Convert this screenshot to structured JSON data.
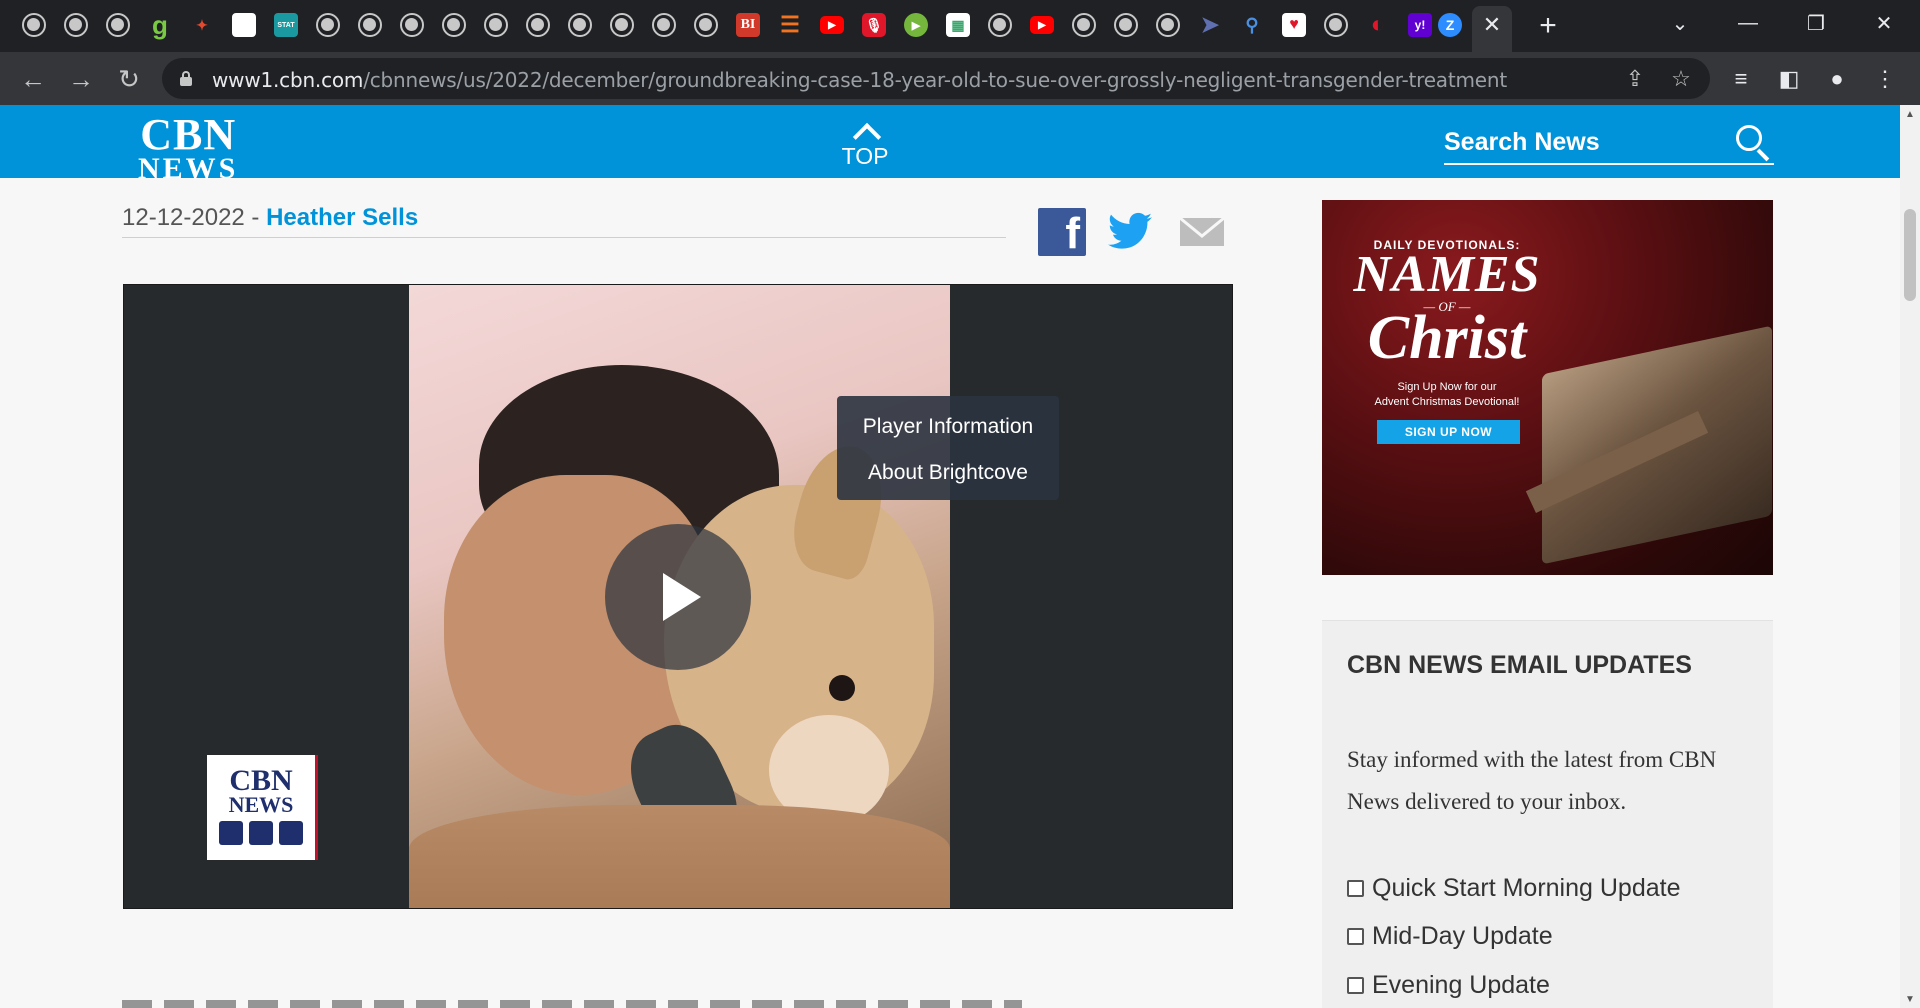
{
  "browser": {
    "url_host": "www1.cbn.com",
    "url_path": "/cbnnews/us/2022/december/groundbreaking-case-18-year-old-to-sue-over-grossly-negligent-transgender-treatment",
    "tab_close_glyph": "✕",
    "new_tab_glyph": "+",
    "favicon_letters": {
      "g": "g",
      "stat": "STAT",
      "bi": "BI",
      "yahoo": "y!",
      "z": "Z"
    },
    "icons": [
      "back-arrow-icon",
      "forward-arrow-icon",
      "reload-icon",
      "lock-icon",
      "share-icon",
      "star-icon",
      "reading-list-icon",
      "side-panel-icon",
      "profile-icon",
      "kebab-menu-icon"
    ]
  },
  "header": {
    "logo_line1": "CBN",
    "logo_line2": "NEWS",
    "top_label": "TOP",
    "search_placeholder": "Search News",
    "color": "#0093d9"
  },
  "article": {
    "date": "12-12-2022",
    "separator": " - ",
    "author": "Heather Sells"
  },
  "share": {
    "facebook_glyph": "f",
    "facebook_color": "#3b5998",
    "twitter_color": "#1da1f2",
    "email_color": "#bdbdbd"
  },
  "player": {
    "context_menu": [
      "Player Information",
      "About Brightcove"
    ],
    "watermark_line1": "CBN",
    "watermark_line2": "NEWS"
  },
  "ad": {
    "kicker": "DAILY DEVOTIONALS:",
    "headline1": "NAMES",
    "of": "— OF —",
    "headline2": "Christ",
    "subtext_line1": "Sign Up Now for our",
    "subtext_line2": "Advent Christmas Devotional!",
    "cta": "SIGN UP NOW"
  },
  "email_updates": {
    "title": "CBN NEWS EMAIL UPDATES",
    "description": "Stay informed with the latest from CBN News delivered to your inbox.",
    "options": [
      "Quick Start Morning Update",
      "Mid-Day Update",
      "Evening Update"
    ]
  }
}
